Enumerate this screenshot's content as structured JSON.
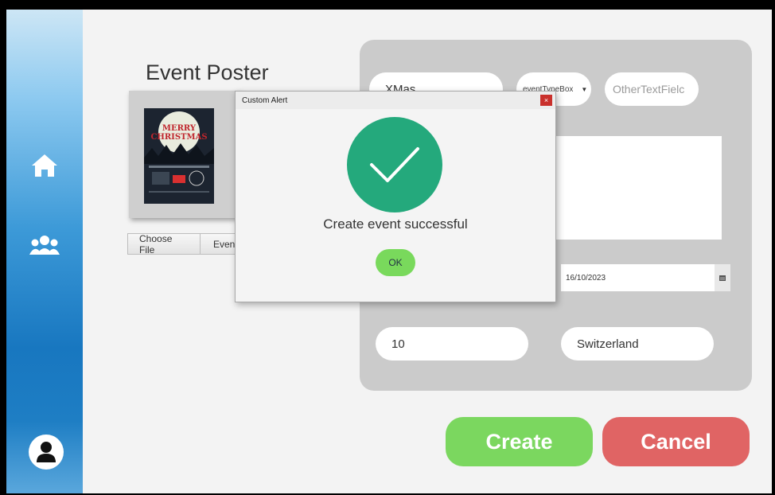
{
  "poster": {
    "title": "Event Poster",
    "image_text": "MERRY CHRISTMAS",
    "choose_file_label": "Choose File",
    "file_name_label": "Even"
  },
  "form": {
    "event_name_value": "XMas",
    "event_type_value": "eventTypeBox",
    "other_text_placeholder": "OtherTextFielc",
    "date_value": "16/10/2023",
    "capacity_value": "10",
    "location_value": "Switzerland"
  },
  "actions": {
    "create_label": "Create",
    "cancel_label": "Cancel"
  },
  "dialog": {
    "title": "Custom Alert",
    "close_label": "×",
    "message": "Create event successful",
    "ok_label": "OK"
  },
  "colors": {
    "create_button": "#7bd75f",
    "cancel_button": "#e06464",
    "success_circle": "#24a97c",
    "ok_button": "#79d95c"
  },
  "icons": {
    "sidebar_home": "home-icon",
    "sidebar_users": "users-icon",
    "profile": "user-icon",
    "calendar": "calendar-icon",
    "success": "checkmark-icon"
  }
}
